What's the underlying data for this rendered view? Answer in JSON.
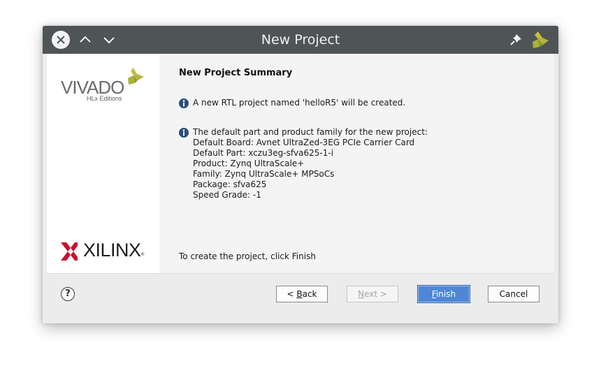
{
  "window": {
    "title": "New Project",
    "buttons": {
      "close_icon": "close-icon",
      "up_icon": "chevron-up-icon",
      "down_icon": "chevron-down-icon",
      "pin_icon": "pin-icon"
    },
    "titlebar_color": "#4f5457"
  },
  "sidebar": {
    "product_logo": "VIVADO",
    "product_edition": "HLx Editions",
    "company_logo": "XILINX",
    "company_reg": "®"
  },
  "summary": {
    "heading": "New Project Summary",
    "message1": "A new RTL project named 'helloR5' will be created.",
    "message2_lines": [
      "The default part and product family for the new project:",
      "Default Board: Avnet UltraZed-3EG PCIe Carrier Card",
      "Default Part: xczu3eg-sfva625-1-i",
      "Product: Zynq UltraScale+",
      "Family: Zynq UltraScale+ MPSoCs",
      "Package: sfva625",
      "Speed Grade: -1"
    ],
    "footer_hint": "To create the project, click Finish"
  },
  "buttons": {
    "help": "?",
    "back_prefix": "< ",
    "back_key": "B",
    "back_rest": "ack",
    "next_key": "N",
    "next_rest": "ext >",
    "finish_key": "F",
    "finish_rest": "inish",
    "cancel": "Cancel"
  },
  "colors": {
    "accent": "#4f86d6",
    "info_icon": "#2d4d7a",
    "vivado_mark_yellow": "#c8c42a",
    "xilinx_red": "#c8102e"
  }
}
